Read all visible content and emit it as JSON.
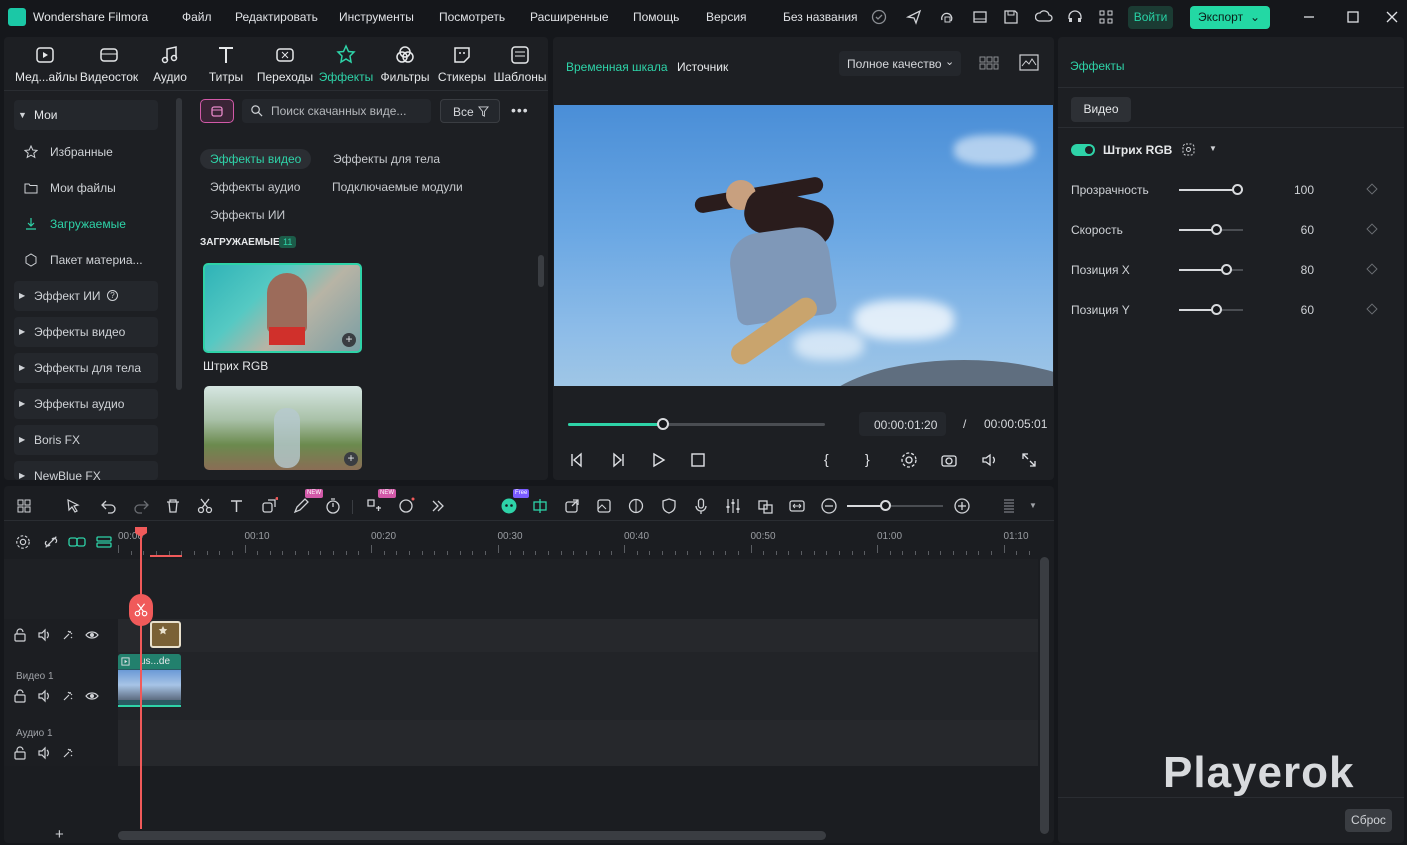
{
  "app": {
    "name": "Wondershare Filmora",
    "project_title": "Без названия",
    "login_label": "Войти",
    "export_label": "Экспорт"
  },
  "menu": [
    "Файл",
    "Редактировать",
    "Инструменты",
    "Посмотреть",
    "Расширенные",
    "Помощь",
    "Версия"
  ],
  "media_tabs": [
    {
      "label": "Мед...айлы",
      "icon": "media-icon"
    },
    {
      "label": "Видеосток",
      "icon": "stock-video-icon"
    },
    {
      "label": "Аудио",
      "icon": "audio-icon"
    },
    {
      "label": "Титры",
      "icon": "titles-icon"
    },
    {
      "label": "Переходы",
      "icon": "transitions-icon"
    },
    {
      "label": "Эффекты",
      "icon": "effects-icon",
      "active": true
    },
    {
      "label": "Фильтры",
      "icon": "filters-icon"
    },
    {
      "label": "Стикеры",
      "icon": "stickers-icon"
    },
    {
      "label": "Шаблоны",
      "icon": "templates-icon"
    }
  ],
  "sidebar": {
    "mine_label": "Мои",
    "sub_items": [
      {
        "label": "Избранные",
        "icon": "star-icon"
      },
      {
        "label": "Мои файлы",
        "icon": "folder-icon"
      },
      {
        "label": "Загружаемые",
        "icon": "download-icon",
        "active": true
      },
      {
        "label": "Пакет материа...",
        "icon": "package-icon"
      }
    ],
    "groups": [
      "Эффект ИИ",
      "Эффекты видео",
      "Эффекты для тела",
      "Эффекты аудио",
      "Boris FX",
      "NewBlue FX"
    ]
  },
  "effects_browser": {
    "search_placeholder": "Поиск скачанных виде...",
    "filter_label": "Все",
    "categories": [
      "Эффекты видео",
      "Эффекты для тела",
      "Эффекты аудио",
      "Подключаемые модули",
      "Эффекты ИИ"
    ],
    "section_title": "ЗАГРУЖАЕМЫЕ",
    "section_count": "11",
    "items": [
      {
        "label": "Штрих RGB"
      },
      {
        "label": ""
      }
    ]
  },
  "preview": {
    "tab_timeline": "Временная шкала",
    "tab_source": "Источник",
    "quality": "Полное качество",
    "current_time": "00:00:01:20",
    "separator": "/",
    "total_time": "00:00:05:01",
    "progress": 0.37
  },
  "properties": {
    "header": "Эффекты",
    "tab_video": "Видео",
    "effect_name": "Штрих RGB",
    "params": [
      {
        "label": "Прозрачность",
        "value": "100",
        "level": 0.9
      },
      {
        "label": "Скорость",
        "value": "60",
        "level": 0.58
      },
      {
        "label": "Позиция X",
        "value": "80",
        "level": 0.73
      },
      {
        "label": "Позиция Y",
        "value": "60",
        "level": 0.58
      }
    ],
    "reset_label": "Сброс",
    "watermark": "Playerok"
  },
  "timeline": {
    "ruler": [
      "00:00",
      "00:10",
      "00:20",
      "00:30",
      "00:40",
      "00:50",
      "01:00",
      "01:10"
    ],
    "tracks": [
      {
        "label": ""
      },
      {
        "label": "Видео 1"
      },
      {
        "label": "Аудио 1"
      }
    ],
    "clip_label": "us...de",
    "badge_new": "NEW",
    "badge_free": "Free"
  },
  "colors": {
    "accent": "#2ed3a8",
    "playhead": "#f05a5a",
    "bg": "#15171b",
    "panel": "#1d1f23"
  }
}
